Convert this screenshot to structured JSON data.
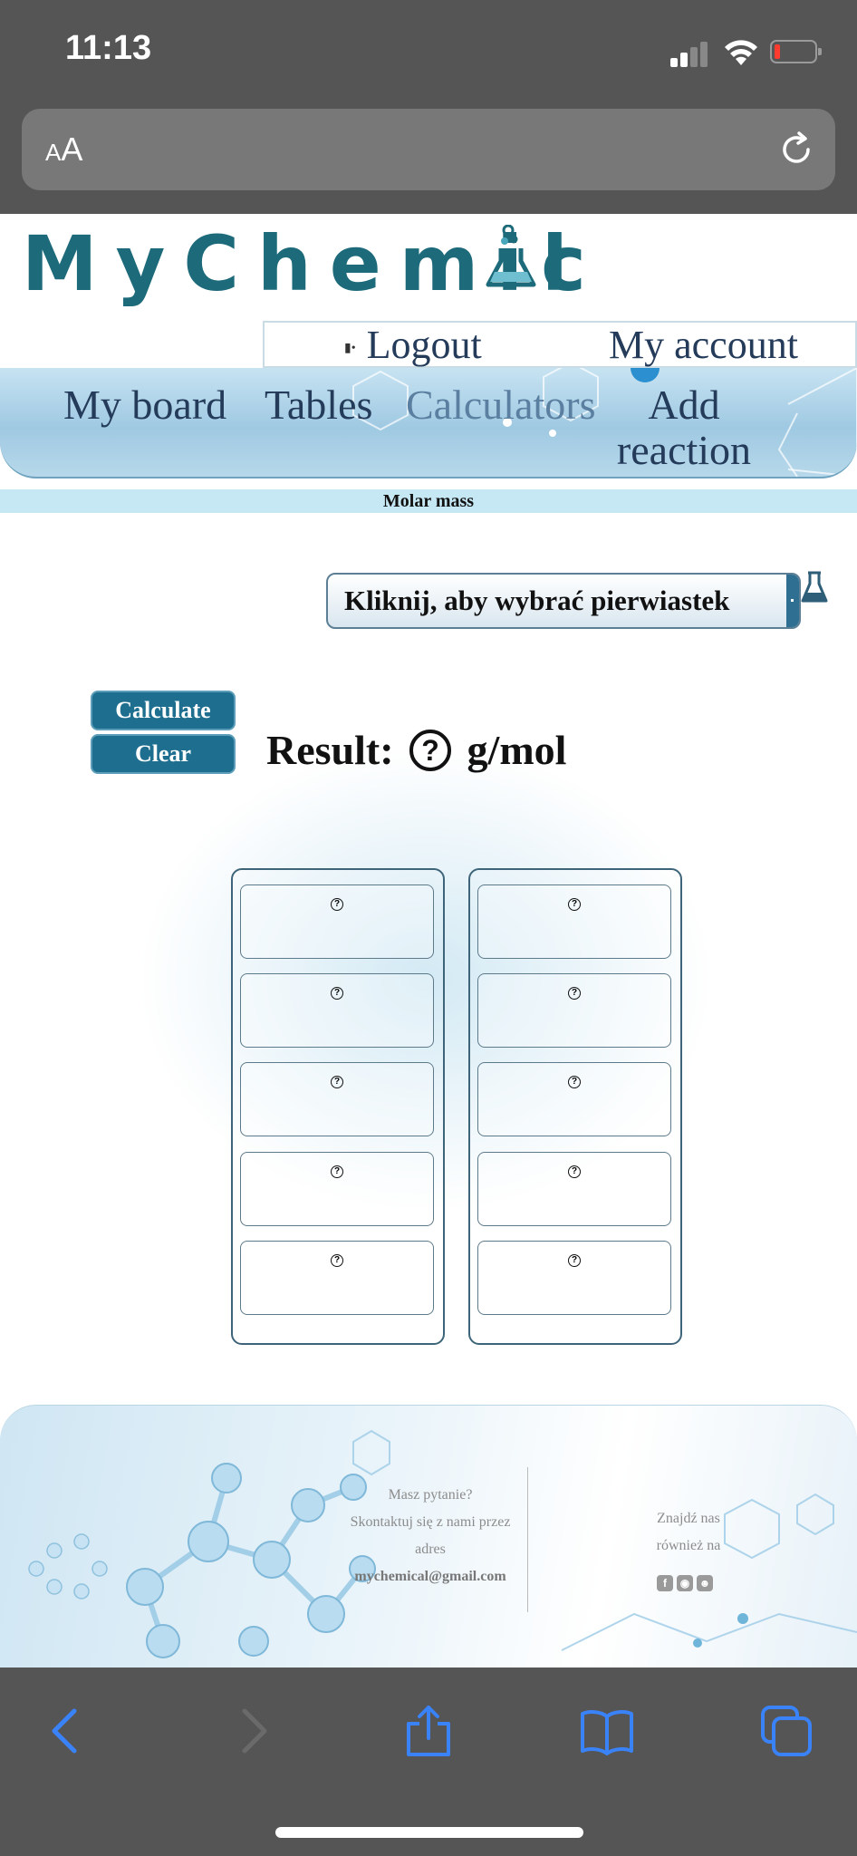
{
  "status_bar": {
    "time": "11:13"
  },
  "address_bar": {
    "aa_small": "A",
    "aa_large": "A"
  },
  "header": {
    "logo_text": "MyChemic",
    "logo_tail": "l",
    "logout_label": "Logout",
    "my_account_label": "My account"
  },
  "nav": {
    "items": [
      {
        "label": "My board"
      },
      {
        "label": "Tables"
      },
      {
        "label": "Calculators"
      },
      {
        "label": "Add reaction"
      }
    ],
    "active": "Calculators"
  },
  "section_title": "Molar mass",
  "calculator": {
    "element_select_label": "Kliknij, aby wybrać pierwiastek",
    "calculate_label": "Calculate",
    "clear_label": "Clear",
    "result_label": "Result:",
    "result_value": "?",
    "result_unit": "g/mol",
    "slot_placeholder": "?"
  },
  "footer": {
    "question": "Masz pytanie?",
    "contact_line1": "Skontaktuj się z nami przez",
    "contact_line2": "adres",
    "email": "mychemical@gmail.com",
    "find_line1": "Znajdź nas",
    "find_line2": "również na",
    "social_icons": [
      "facebook-icon",
      "instagram-icon",
      "snapchat-icon"
    ]
  },
  "colors": {
    "brand": "#1d6a7a",
    "button": "#1d6e8f",
    "nav_text": "#243b5a",
    "chrome": "#555555",
    "ios_blue": "#3a82f7"
  }
}
